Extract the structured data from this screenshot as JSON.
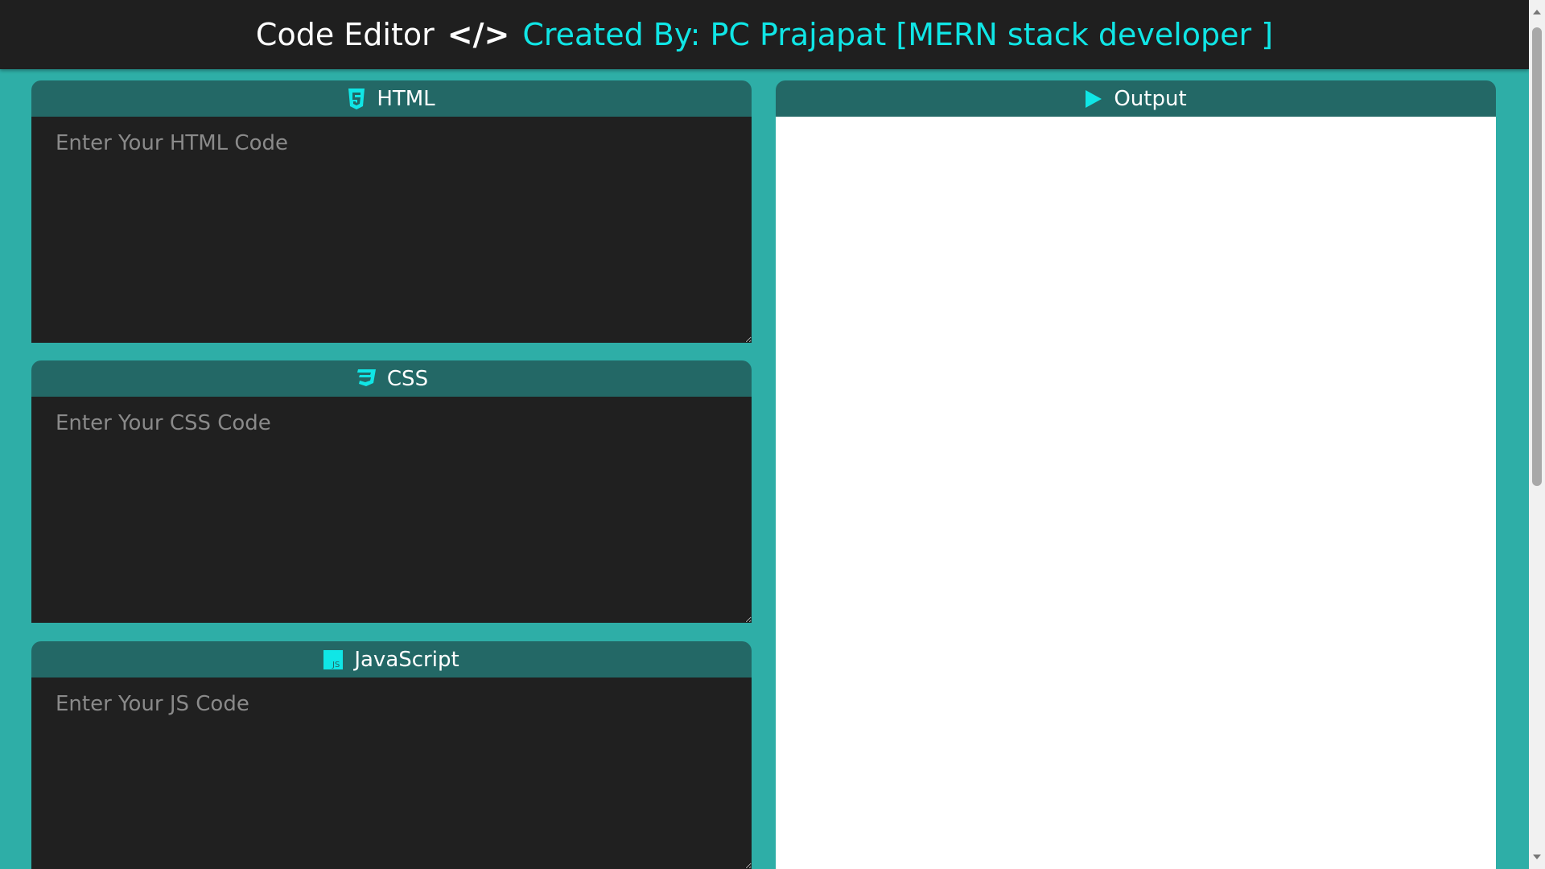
{
  "header": {
    "title": "Code Editor",
    "code_icon": "</>",
    "credit": "Created By: PC Prajapat [MERN stack developer ]"
  },
  "panels": {
    "html": {
      "label": "HTML",
      "icon": "html5-icon",
      "placeholder": "Enter Your HTML Code"
    },
    "css": {
      "label": "CSS",
      "icon": "css3-icon",
      "placeholder": "Enter Your CSS Code"
    },
    "js": {
      "label": "JavaScript",
      "icon": "js-icon",
      "placeholder": "Enter Your JS Code"
    },
    "output": {
      "label": "Output",
      "icon": "play-icon"
    }
  },
  "colors": {
    "accent": "#10e6e6",
    "background": "#2eaea7",
    "panel_header": "#236866",
    "editor": "#202020",
    "topbar": "#1f1f1f"
  }
}
